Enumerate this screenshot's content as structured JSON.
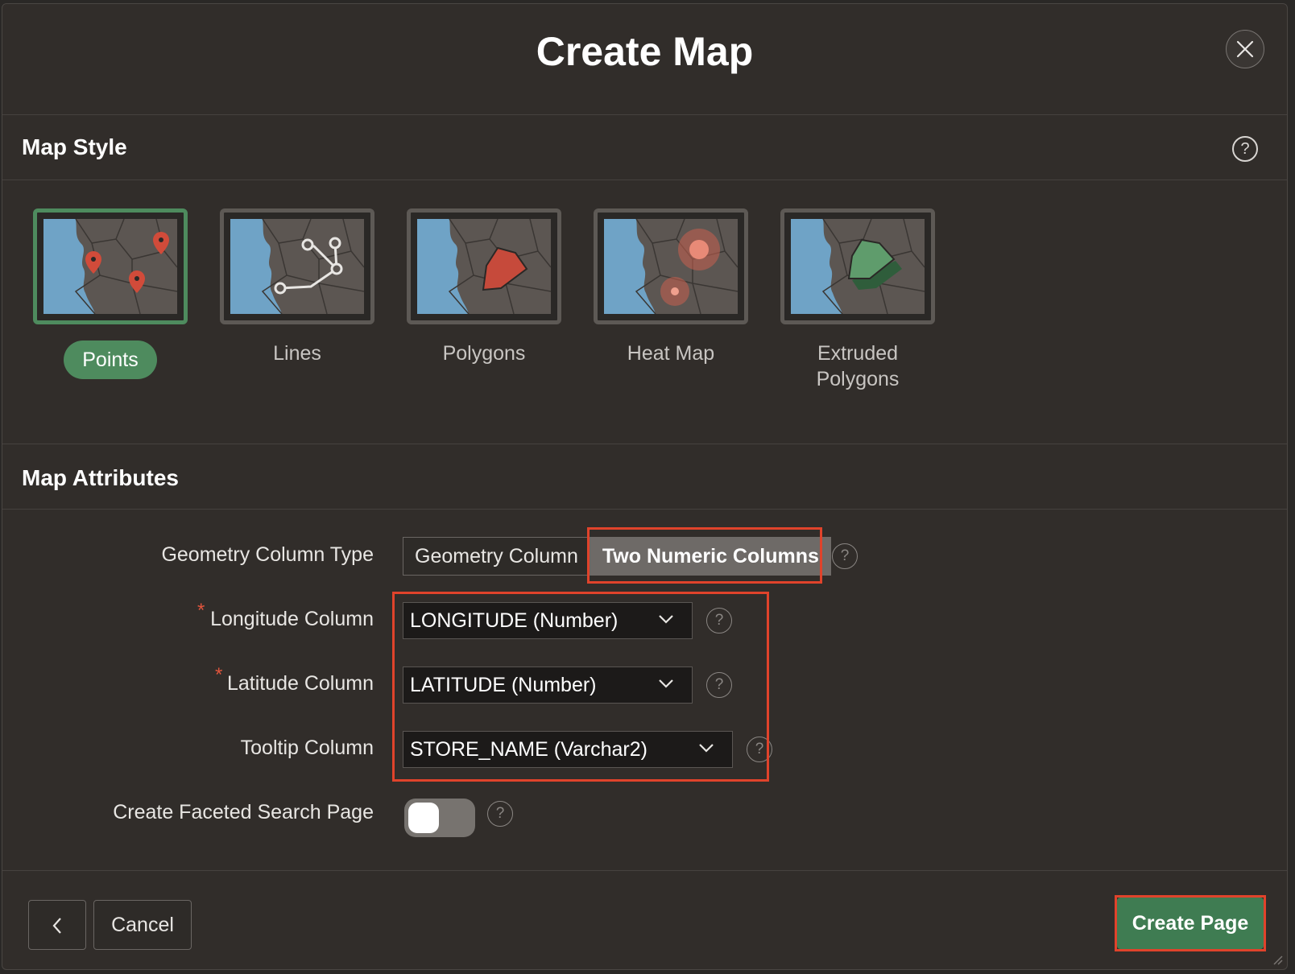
{
  "dialog": {
    "title": "Create Map",
    "close_icon": "close-icon"
  },
  "map_style": {
    "heading": "Map Style",
    "help_icon": "help-icon",
    "options": [
      {
        "label": "Points",
        "icon": "map-points-icon",
        "selected": true
      },
      {
        "label": "Lines",
        "icon": "map-lines-icon",
        "selected": false
      },
      {
        "label": "Polygons",
        "icon": "map-polygons-icon",
        "selected": false
      },
      {
        "label": "Heat Map",
        "icon": "map-heatmap-icon",
        "selected": false
      },
      {
        "label": "Extruded\nPolygons",
        "icon": "map-extruded-polygons-icon",
        "selected": false
      }
    ]
  },
  "map_attributes": {
    "heading": "Map Attributes",
    "geometry_type": {
      "label": "Geometry Column Type",
      "options": [
        "Geometry Column",
        "Two Numeric Columns"
      ],
      "selected": "Two Numeric Columns"
    },
    "longitude": {
      "label": "Longitude Column",
      "required_mark": "*",
      "value": "LONGITUDE (Number)"
    },
    "latitude": {
      "label": "Latitude Column",
      "required_mark": "*",
      "value": "LATITUDE (Number)"
    },
    "tooltip": {
      "label": "Tooltip Column",
      "value": "STORE_NAME (Varchar2)"
    },
    "faceted": {
      "label": "Create Faceted Search Page",
      "enabled": false
    }
  },
  "footer": {
    "back_icon": "chevron-left-icon",
    "cancel_label": "Cancel",
    "create_label": "Create Page"
  },
  "colors": {
    "accent_green": "#4e8b5e",
    "primary_button": "#3f7c52",
    "highlight_red": "#e0432b",
    "background": "#312d2a"
  }
}
